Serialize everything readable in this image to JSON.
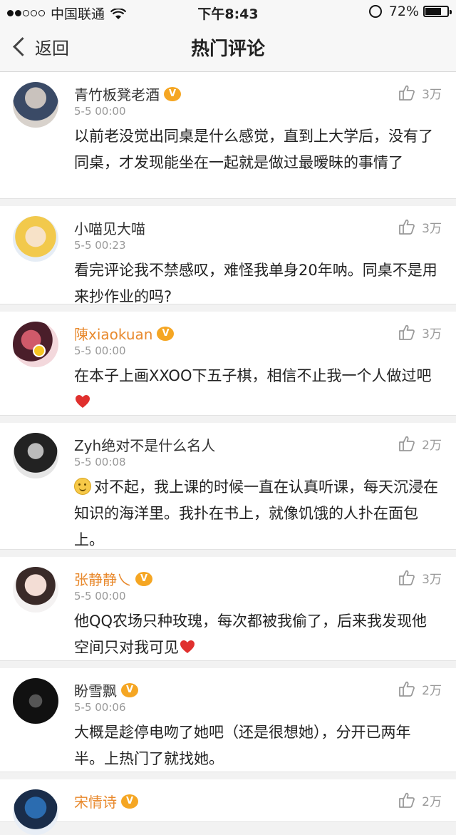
{
  "status_bar": {
    "carrier": "中国联通",
    "time": "下午8:43",
    "battery": "72%",
    "battery_level": 0.72
  },
  "nav": {
    "back_label": "返回",
    "title": "热门评论"
  },
  "comments": [
    {
      "username": "青竹板凳老酒",
      "badge": true,
      "name_color": "#333333",
      "time": "5-5 00:00",
      "likes": "3万",
      "text": "以前老没觉出同桌是什么感觉，直到上大学后，没有了同桌，才发现能坐在一起就是做过最暧昧的事情了"
    },
    {
      "username": "小喵见大喵",
      "badge": false,
      "name_color": "#333333",
      "time": "5-5 00:23",
      "likes": "3万",
      "text": "看完评论我不禁感叹，难怪我单身20年呐。同桌不是用来抄作业的吗?"
    },
    {
      "username": "陳xiaokuan",
      "badge": true,
      "name_color": "#e8892d",
      "time": "5-5 00:00",
      "likes": "3万",
      "text": "在本子上画XXOO下五子棋，相信不止我一个人做过吧",
      "trailing_icon": "heart-icon"
    },
    {
      "username": "Zyh绝对不是什么名人",
      "badge": false,
      "name_color": "#333333",
      "time": "5-5 00:08",
      "likes": "2万",
      "leading_icon": "smile-icon",
      "text": "对不起，我上课的时候一直在认真听课，每天沉浸在知识的海洋里。我扑在书上，就像饥饿的人扑在面包上。"
    },
    {
      "username": "张静静乀",
      "badge": true,
      "name_color": "#e8892d",
      "time": "5-5 00:00",
      "likes": "3万",
      "text": "他QQ农场只种玫瑰，每次都被我偷了，后来我发现他空间只对我可见",
      "trailing_icon": "heart-icon"
    },
    {
      "username": "盼雪飘",
      "badge": true,
      "name_color": "#333333",
      "time": "5-5 00:06",
      "likes": "2万",
      "text": "大概是趁停电吻了她吧（还是很想她），分开已两年半。上热门了就找她。"
    },
    {
      "username": "宋情诗",
      "badge": true,
      "name_color": "#e8892d",
      "time": "",
      "likes": "2万",
      "text": ""
    }
  ],
  "colors": {
    "accent_orange": "#e8892d",
    "badge_gold": "#f5a623",
    "heart_red": "#e0302e"
  }
}
